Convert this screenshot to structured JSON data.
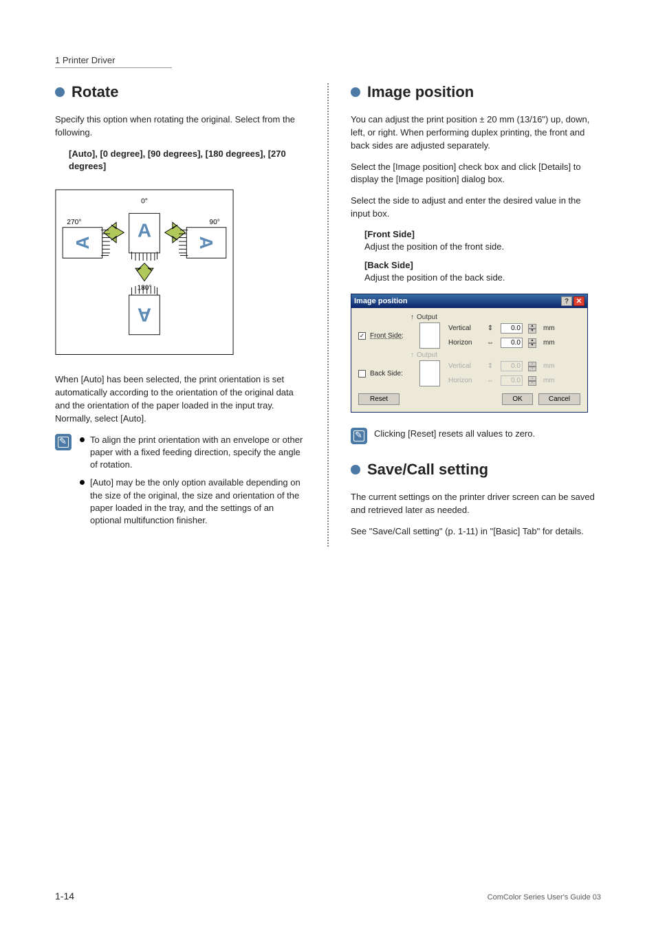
{
  "header": {
    "crumb": "1 Printer Driver"
  },
  "left": {
    "rotate": {
      "title": "Rotate",
      "intro": "Specify this option when rotating the original. Select from the following.",
      "options": "[Auto], [0 degree], [90 degrees], [180 degrees], [270 degrees]",
      "fig": {
        "d0": "0°",
        "d90": "90°",
        "d180": "180°",
        "d270": "270°"
      },
      "auto_desc": "When [Auto] has been selected, the print orientation is set automatically according to the orientation of the original data and the orientation of the paper loaded in the input tray. Normally, select [Auto].",
      "notes": [
        "To align the print orientation with an envelope or other paper with a fixed feeding direction, specify the angle of rotation.",
        "[Auto] may be the only option available depending on the size of the original, the size and orientation of the paper loaded in the tray, and the settings of an optional multifunction finisher."
      ]
    }
  },
  "right": {
    "imgpos": {
      "title": "Image position",
      "p1": "You can adjust the print position ± 20 mm (13/16\") up, down, left, or right. When performing duplex printing, the front and back sides are adjusted separately.",
      "p2": "Select the [Image position] check box and click [Details] to display the [Image position] dialog box.",
      "p3": "Select the side to adjust and enter the desired value in the input box.",
      "front_h": "[Front Side]",
      "front_d": "Adjust the position of the front side.",
      "back_h": "[Back Side]",
      "back_d": "Adjust the position of the back side.",
      "dialog": {
        "title": "Image position",
        "output": "Output",
        "front": "Front Side:",
        "back": "Back Side:",
        "vertical": "Vertical",
        "horizon": "Horizon",
        "val": "0.0",
        "mm": "mm",
        "reset": "Reset",
        "ok": "OK",
        "cancel": "Cancel",
        "checkmark": "✓"
      },
      "note": "Clicking [Reset] resets all values to zero."
    },
    "savecall": {
      "title": "Save/Call setting",
      "p1": "The current settings on the printer driver screen can be saved and retrieved later as needed.",
      "p2": "See \"Save/Call setting\" (p. 1-11) in \"[Basic] Tab\" for details."
    }
  },
  "page_num": "1-14",
  "footer": "ComColor Series User's Guide 03"
}
